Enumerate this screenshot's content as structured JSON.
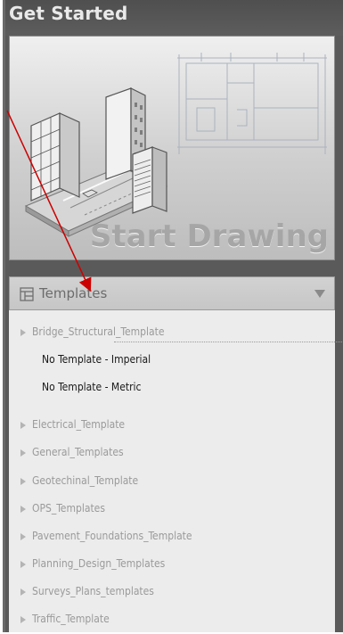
{
  "panel": {
    "title": "Get Started",
    "start_drawing": "Start Drawing"
  },
  "templates": {
    "label": "Templates",
    "items": [
      {
        "label": "Bridge_Structural_Template",
        "kind": "folder"
      },
      {
        "label": "No Template - Imperial",
        "kind": "template"
      },
      {
        "label": "No Template - Metric",
        "kind": "template"
      },
      {
        "label": "Electrical_Template",
        "kind": "folder"
      },
      {
        "label": "General_Templates",
        "kind": "folder"
      },
      {
        "label": "Geotechinal_Template",
        "kind": "folder"
      },
      {
        "label": "OPS_Templates",
        "kind": "folder"
      },
      {
        "label": "Pavement_Foundations_Template",
        "kind": "folder"
      },
      {
        "label": "Planning_Design_Templates",
        "kind": "folder"
      },
      {
        "label": "Surveys_Plans_templates",
        "kind": "folder"
      },
      {
        "label": "Traffic_Template",
        "kind": "folder"
      }
    ]
  },
  "colors": {
    "panel": "#5a5a5a",
    "header_text": "#e9e9e9",
    "start_text": "#a6a6a6",
    "list_bg": "#ececec",
    "folder_text": "#9a9a9a",
    "template_text": "#1a1a1a",
    "annotation_arrow": "#cc0000"
  }
}
